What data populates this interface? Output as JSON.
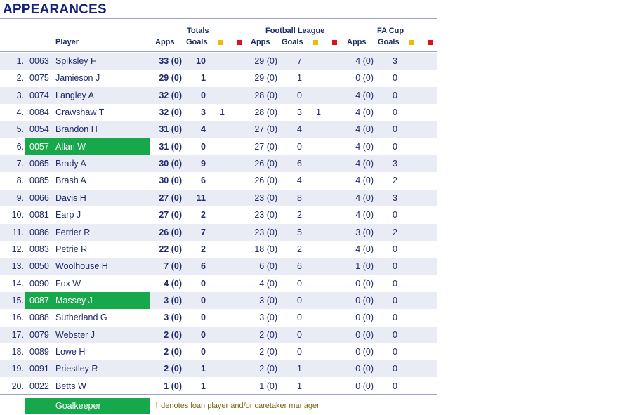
{
  "title": "APPEARANCES",
  "headers": {
    "player": "Player",
    "totals": "Totals",
    "football_league": "Football League",
    "fa_cup": "FA Cup",
    "apps": "Apps",
    "goals": "Goals"
  },
  "colors": {
    "goalkeeper": "#17a84b",
    "yellow_card": "#f5b800",
    "red_card": "#e0101a",
    "alt_row": "#e9ebf5",
    "text": "#1f2a6b"
  },
  "rows": [
    {
      "rank": "1.",
      "code": "0063",
      "name": "Spiksley F",
      "t_apps": "33 (0)",
      "t_goals": "10",
      "t_yellow": "",
      "fl_apps": "29 (0)",
      "fl_goals": "7",
      "fl_yellow": "",
      "fa_apps": "4 (0)",
      "fa_goals": "3",
      "gk": false
    },
    {
      "rank": "2.",
      "code": "0075",
      "name": "Jamieson J",
      "t_apps": "29 (0)",
      "t_goals": "1",
      "t_yellow": "",
      "fl_apps": "29 (0)",
      "fl_goals": "1",
      "fl_yellow": "",
      "fa_apps": "0 (0)",
      "fa_goals": "0",
      "gk": false
    },
    {
      "rank": "3.",
      "code": "0074",
      "name": "Langley A",
      "t_apps": "32 (0)",
      "t_goals": "0",
      "t_yellow": "",
      "fl_apps": "28 (0)",
      "fl_goals": "0",
      "fl_yellow": "",
      "fa_apps": "4 (0)",
      "fa_goals": "0",
      "gk": false
    },
    {
      "rank": "4.",
      "code": "0084",
      "name": "Crawshaw T",
      "t_apps": "32 (0)",
      "t_goals": "3",
      "t_yellow": "1",
      "fl_apps": "28 (0)",
      "fl_goals": "3",
      "fl_yellow": "1",
      "fa_apps": "4 (0)",
      "fa_goals": "0",
      "gk": false
    },
    {
      "rank": "5.",
      "code": "0054",
      "name": "Brandon H",
      "t_apps": "31 (0)",
      "t_goals": "4",
      "t_yellow": "",
      "fl_apps": "27 (0)",
      "fl_goals": "4",
      "fl_yellow": "",
      "fa_apps": "4 (0)",
      "fa_goals": "0",
      "gk": false
    },
    {
      "rank": "6.",
      "code": "0057",
      "name": "Allan W",
      "t_apps": "31 (0)",
      "t_goals": "0",
      "t_yellow": "",
      "fl_apps": "27 (0)",
      "fl_goals": "0",
      "fl_yellow": "",
      "fa_apps": "4 (0)",
      "fa_goals": "0",
      "gk": true
    },
    {
      "rank": "7.",
      "code": "0065",
      "name": "Brady A",
      "t_apps": "30 (0)",
      "t_goals": "9",
      "t_yellow": "",
      "fl_apps": "26 (0)",
      "fl_goals": "6",
      "fl_yellow": "",
      "fa_apps": "4 (0)",
      "fa_goals": "3",
      "gk": false
    },
    {
      "rank": "8.",
      "code": "0085",
      "name": "Brash A",
      "t_apps": "30 (0)",
      "t_goals": "6",
      "t_yellow": "",
      "fl_apps": "26 (0)",
      "fl_goals": "4",
      "fl_yellow": "",
      "fa_apps": "4 (0)",
      "fa_goals": "2",
      "gk": false
    },
    {
      "rank": "9.",
      "code": "0066",
      "name": "Davis H",
      "t_apps": "27 (0)",
      "t_goals": "11",
      "t_yellow": "",
      "fl_apps": "23 (0)",
      "fl_goals": "8",
      "fl_yellow": "",
      "fa_apps": "4 (0)",
      "fa_goals": "3",
      "gk": false
    },
    {
      "rank": "10.",
      "code": "0081",
      "name": "Earp J",
      "t_apps": "27 (0)",
      "t_goals": "2",
      "t_yellow": "",
      "fl_apps": "23 (0)",
      "fl_goals": "2",
      "fl_yellow": "",
      "fa_apps": "4 (0)",
      "fa_goals": "0",
      "gk": false
    },
    {
      "rank": "11.",
      "code": "0086",
      "name": "Ferrier R",
      "t_apps": "26 (0)",
      "t_goals": "7",
      "t_yellow": "",
      "fl_apps": "23 (0)",
      "fl_goals": "5",
      "fl_yellow": "",
      "fa_apps": "3 (0)",
      "fa_goals": "2",
      "gk": false
    },
    {
      "rank": "12.",
      "code": "0083",
      "name": "Petrie R",
      "t_apps": "22 (0)",
      "t_goals": "2",
      "t_yellow": "",
      "fl_apps": "18 (0)",
      "fl_goals": "2",
      "fl_yellow": "",
      "fa_apps": "4 (0)",
      "fa_goals": "0",
      "gk": false
    },
    {
      "rank": "13.",
      "code": "0050",
      "name": "Woolhouse H",
      "t_apps": "7 (0)",
      "t_goals": "6",
      "t_yellow": "",
      "fl_apps": "6 (0)",
      "fl_goals": "6",
      "fl_yellow": "",
      "fa_apps": "1 (0)",
      "fa_goals": "0",
      "gk": false
    },
    {
      "rank": "14.",
      "code": "0090",
      "name": "Fox W",
      "t_apps": "4 (0)",
      "t_goals": "0",
      "t_yellow": "",
      "fl_apps": "4 (0)",
      "fl_goals": "0",
      "fl_yellow": "",
      "fa_apps": "0 (0)",
      "fa_goals": "0",
      "gk": false
    },
    {
      "rank": "15.",
      "code": "0087",
      "name": "Massey J",
      "t_apps": "3 (0)",
      "t_goals": "0",
      "t_yellow": "",
      "fl_apps": "3 (0)",
      "fl_goals": "0",
      "fl_yellow": "",
      "fa_apps": "0 (0)",
      "fa_goals": "0",
      "gk": true
    },
    {
      "rank": "16.",
      "code": "0088",
      "name": "Sutherland G",
      "t_apps": "3 (0)",
      "t_goals": "0",
      "t_yellow": "",
      "fl_apps": "3 (0)",
      "fl_goals": "0",
      "fl_yellow": "",
      "fa_apps": "0 (0)",
      "fa_goals": "0",
      "gk": false
    },
    {
      "rank": "17.",
      "code": "0079",
      "name": "Webster J",
      "t_apps": "2 (0)",
      "t_goals": "0",
      "t_yellow": "",
      "fl_apps": "2 (0)",
      "fl_goals": "0",
      "fl_yellow": "",
      "fa_apps": "0 (0)",
      "fa_goals": "0",
      "gk": false
    },
    {
      "rank": "18.",
      "code": "0089",
      "name": "Lowe H",
      "t_apps": "2 (0)",
      "t_goals": "0",
      "t_yellow": "",
      "fl_apps": "2 (0)",
      "fl_goals": "0",
      "fl_yellow": "",
      "fa_apps": "0 (0)",
      "fa_goals": "0",
      "gk": false
    },
    {
      "rank": "19.",
      "code": "0091",
      "name": "Priestley R",
      "t_apps": "2 (0)",
      "t_goals": "1",
      "t_yellow": "",
      "fl_apps": "2 (0)",
      "fl_goals": "1",
      "fl_yellow": "",
      "fa_apps": "0 (0)",
      "fa_goals": "0",
      "gk": false
    },
    {
      "rank": "20.",
      "code": "0022",
      "name": "Betts W",
      "t_apps": "1 (0)",
      "t_goals": "1",
      "t_yellow": "",
      "fl_apps": "1 (0)",
      "fl_goals": "1",
      "fl_yellow": "",
      "fa_apps": "0 (0)",
      "fa_goals": "0",
      "gk": false
    }
  ],
  "legend": {
    "goalkeeper_label": "Goalkeeper",
    "note": "† denotes loan player and/or caretaker manager"
  }
}
